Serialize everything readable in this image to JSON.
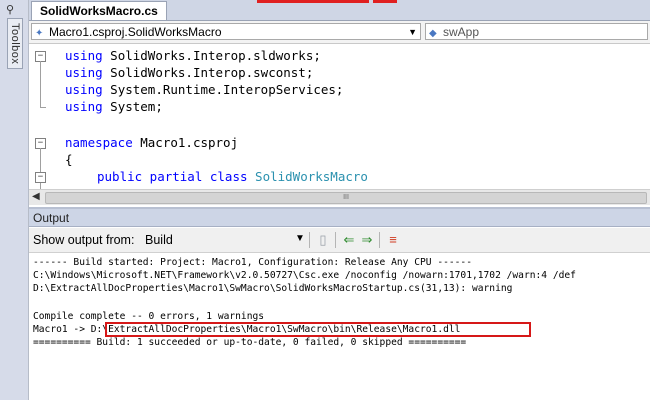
{
  "toolbox": {
    "label": "Toolbox",
    "pin_icon": "pin-icon"
  },
  "tabs": [
    {
      "label": "SolidWorksMacro.cs"
    }
  ],
  "nav": {
    "class_combo": "Macro1.csproj.SolidWorksMacro",
    "member_combo": "swApp"
  },
  "code": {
    "lines": [
      {
        "kw": "using",
        "rest": " SolidWorks.Interop.sldworks;"
      },
      {
        "kw": "using",
        "rest": " SolidWorks.Interop.swconst;"
      },
      {
        "kw": "using",
        "rest": " System.Runtime.InteropServices;"
      },
      {
        "kw": "using",
        "rest": " System;"
      }
    ],
    "namespace_kw": "namespace",
    "namespace_name": " Macro1.csproj",
    "open_brace": "{",
    "class_kw": "public partial class",
    "class_name": "SolidWorksMacro"
  },
  "scrollbar": {
    "grip": "III"
  },
  "output": {
    "title": "Output",
    "show_from_label": "Show output from:",
    "show_from_value": "Build",
    "lines": [
      "------ Build started: Project: Macro1, Configuration: Release Any CPU ------",
      "C:\\Windows\\Microsoft.NET\\Framework\\v2.0.50727\\Csc.exe /noconfig /nowarn:1701,1702 /warn:4 /def",
      "D:\\ExtractAllDocProperties\\Macro1\\SwMacro\\SolidWorksMacroStartup.cs(31,13): warning",
      "",
      "Compile complete -- 0 errors, 1 warnings",
      "Macro1 -> D:\\ExtractAllDocProperties\\Macro1\\SwMacro\\bin\\Release\\Macro1.dll",
      "========== Build: 1 succeeded or up-to-date, 0 failed, 0 skipped =========="
    ]
  },
  "colors": {
    "keyword": "#0000ff",
    "type": "#2b91af",
    "highlight_box": "#d61818"
  }
}
